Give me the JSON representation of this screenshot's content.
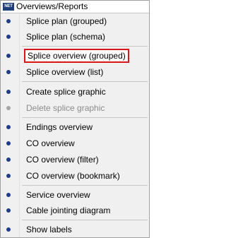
{
  "menu": {
    "title": "Overviews/Reports",
    "title_icon_text": "NET",
    "items": [
      {
        "label": "Splice plan (grouped)",
        "enabled": true
      },
      {
        "label": "Splice plan (schema)",
        "enabled": true
      },
      {
        "label": "Splice overview (grouped)",
        "enabled": true,
        "highlighted": true
      },
      {
        "label": "Splice overview (list)",
        "enabled": true
      },
      {
        "label": "Create splice graphic",
        "enabled": true
      },
      {
        "label": "Delete splice graphic",
        "enabled": false
      },
      {
        "label": "Endings overview",
        "enabled": true
      },
      {
        "label": "CO overview",
        "enabled": true
      },
      {
        "label": "CO overview (filter)",
        "enabled": true
      },
      {
        "label": "CO overview (bookmark)",
        "enabled": true
      },
      {
        "label": "Service overview",
        "enabled": true
      },
      {
        "label": "Cable jointing diagram",
        "enabled": true
      },
      {
        "label": "Show labels",
        "enabled": true
      }
    ]
  },
  "colors": {
    "bullet": "#1f3c88",
    "bullet_disabled": "#a5a5a5",
    "highlight_border": "#d8161a",
    "menu_background": "#f0f0f0"
  }
}
